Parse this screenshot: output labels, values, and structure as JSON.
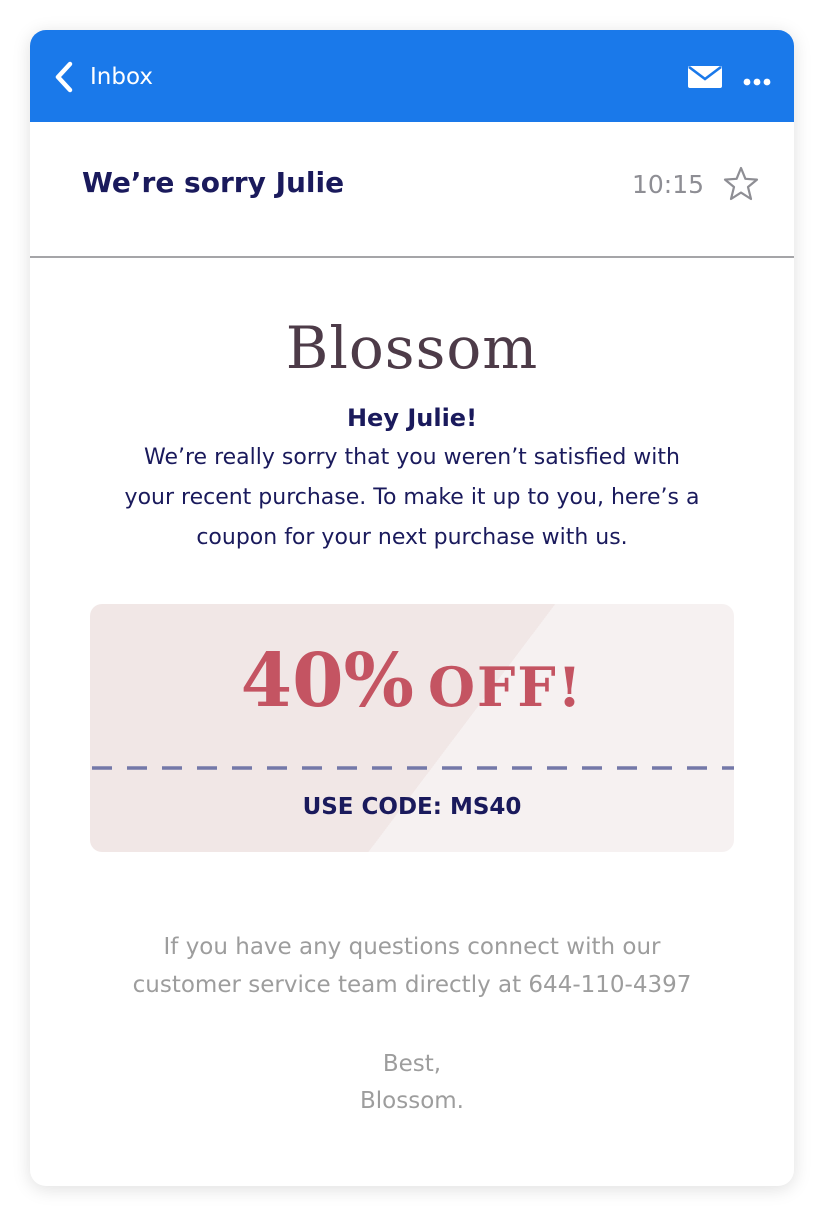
{
  "app": {
    "back_label": "Inbox",
    "icons": [
      "chevron-left-icon",
      "mail-icon",
      "more-icon",
      "star-icon"
    ],
    "accent_color": "#1a79ea"
  },
  "email": {
    "subject": "We’re sorry Julie",
    "time": "10:15",
    "starred": false
  },
  "content": {
    "brand": "Blossom",
    "greeting": "Hey Julie!",
    "body_lines": [
      "We’re really sorry that you weren’t satisfied with",
      "your recent purchase. To make it up to you, here’s a",
      "coupon for your next purchase with us."
    ],
    "coupon": {
      "percent": "40%",
      "off": "OFF!",
      "code": "USE CODE: MS40",
      "color": "#c45462"
    },
    "contact_lines": [
      "If you have any questions connect with our",
      "customer service team directly at 644-110-4397"
    ],
    "signoff_lines": [
      "Best,",
      "Blossom."
    ]
  }
}
